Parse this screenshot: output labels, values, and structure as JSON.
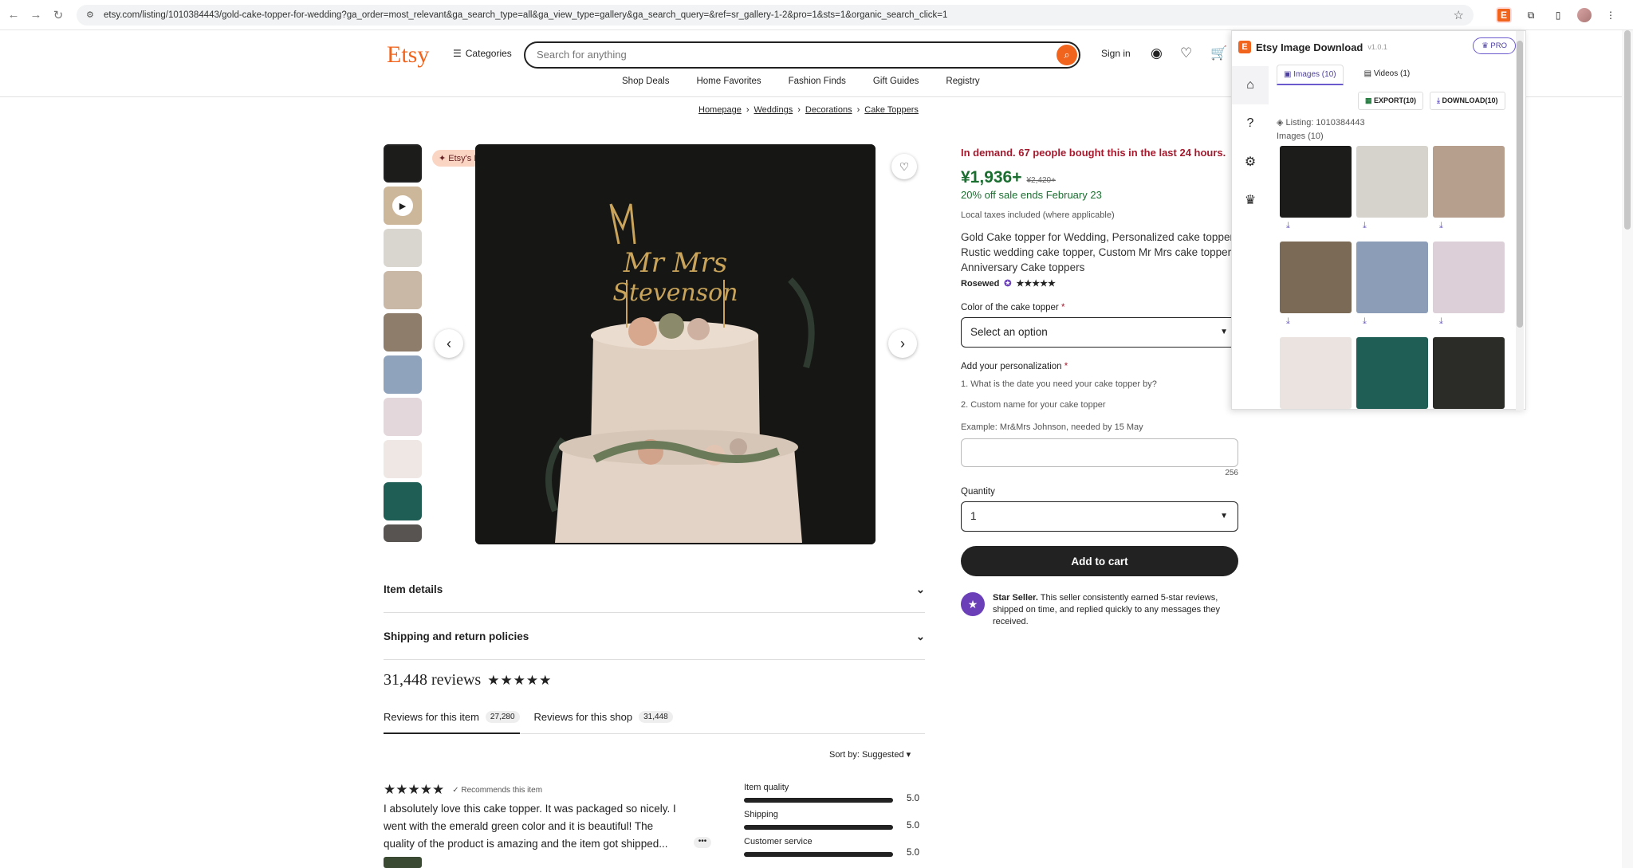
{
  "browser": {
    "url": "etsy.com/listing/1010384443/gold-cake-topper-for-wedding?ga_order=most_relevant&ga_search_type=all&ga_view_type=gallery&ga_search_query=&ref=sr_gallery-1-2&pro=1&sts=1&organic_search_click=1"
  },
  "header": {
    "logo": "Etsy",
    "categories_label": "Categories",
    "search_placeholder": "Search for anything",
    "signin_label": "Sign in",
    "subnav": [
      "Shop Deals",
      "Home Favorites",
      "Fashion Finds",
      "Gift Guides",
      "Registry"
    ]
  },
  "breadcrumb": [
    "Homepage",
    "Weddings",
    "Decorations",
    "Cake Toppers"
  ],
  "gallery": {
    "badge": "Etsy's Pick"
  },
  "product": {
    "in_demand": "In demand. 67 people bought this in the last 24 hours.",
    "price": "¥1,936+",
    "old_price": "¥2,420+",
    "sale": "20% off sale ends February 23",
    "taxes": "Local taxes included (where applicable)",
    "title": "Gold Cake topper for Wedding, Personalized cake topper, Rustic wedding cake topper, Custom Mr Mrs cake topper, Anniversary Cake toppers",
    "seller": "Rosewed",
    "color_label": "Color of the cake topper",
    "color_value": "Select an option",
    "personalization_label": "Add your personalization",
    "q1": "1. What is the date you need your cake topper by?",
    "q2": "2. Custom name for your cake topper",
    "example": "Example: Mr&Mrs Johnson, needed by 15 May",
    "char_count": "256",
    "quantity_label": "Quantity",
    "quantity_value": "1",
    "add_to_cart": "Add to cart",
    "star_seller_title": "Star Seller.",
    "star_seller_text": "This seller consistently earned 5-star reviews, shipped on time, and replied quickly to any messages they received."
  },
  "sections": {
    "item_details": "Item details",
    "shipping": "Shipping and return policies"
  },
  "reviews": {
    "title": "31,448 reviews",
    "tab_item": "Reviews for this item",
    "tab_item_count": "27,280",
    "tab_shop": "Reviews for this shop",
    "tab_shop_count": "31,448",
    "sort": "Sort by: Suggested",
    "recommends": "✓ Recommends this item",
    "text": "I absolutely love this cake topper. It was packaged so nicely. I went with the emerald green color and it is beautiful! The quality of the product is amazing and the item got shipped...",
    "ratings": [
      {
        "label": "Item quality",
        "value": "5.0"
      },
      {
        "label": "Shipping",
        "value": "5.0"
      },
      {
        "label": "Customer service",
        "value": "5.0"
      }
    ]
  },
  "extension": {
    "title": "Etsy Image Download",
    "version": "v1.0.1",
    "pro": "PRO",
    "tab_images": "Images (10)",
    "tab_videos": "Videos (1)",
    "export": "EXPORT(10)",
    "download": "DOWNLOAD(10)",
    "listing": "Listing: 1010384443",
    "images_count": "Images (10)"
  },
  "colors": {
    "brand": "#f1641e",
    "sale_green": "#1a6e2f",
    "demand_red": "#a61a2e",
    "extension_accent": "#6a5acd"
  }
}
